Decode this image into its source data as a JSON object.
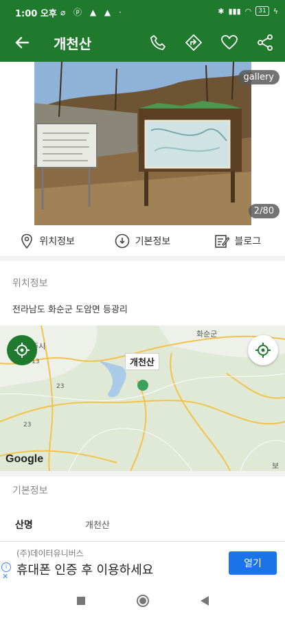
{
  "status_bar": {
    "time": "1:00 오후",
    "left_icons": "⌀ ⓟ ▲ ▲ ·",
    "battery": "31"
  },
  "app_bar": {
    "title": "개천산"
  },
  "hero": {
    "gallery_label": "gallery",
    "counter": "2/80"
  },
  "tabs": [
    {
      "label": "위치정보",
      "icon": "location-pin-icon"
    },
    {
      "label": "기본정보",
      "icon": "info-icon"
    },
    {
      "label": "블로그",
      "icon": "edit-icon"
    }
  ],
  "location": {
    "heading": "위치정보",
    "address": "전라남도 화순군 도암면 등광리"
  },
  "map": {
    "pin_label": "개천산",
    "logo": "Google",
    "labels": [
      "화순군",
      "주시",
      "보성"
    ],
    "road_numbers": [
      "13",
      "23",
      "23"
    ]
  },
  "basic_info": {
    "heading": "기본정보",
    "rows": [
      {
        "key": "산명",
        "value": "개천산"
      }
    ]
  },
  "ad": {
    "sponsor": "(주)데이터유니버스",
    "headline": "휴대폰 인증 후 이용하세요",
    "button": "열기"
  },
  "colors": {
    "brand": "#1f7a2e",
    "ad_button": "#1a73e8"
  }
}
